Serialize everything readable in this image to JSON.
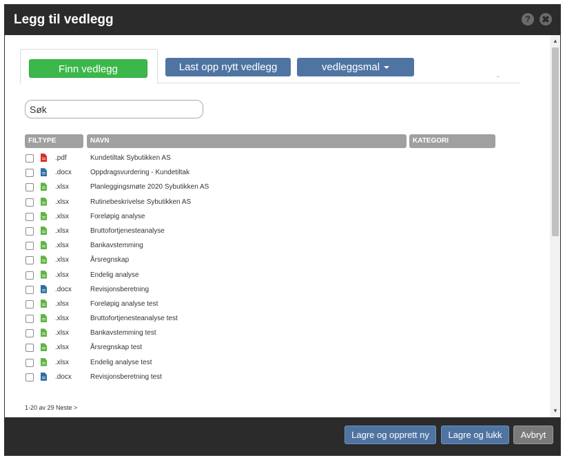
{
  "dialog": {
    "title": "Legg til vedlegg"
  },
  "header_icons": {
    "help": "?",
    "close": "✖"
  },
  "tabs": {
    "find_label": "Finn vedlegg",
    "upload_label": "Last opp nytt vedlegg",
    "template_label": "vedleggsmal"
  },
  "search": {
    "placeholder": "Søk",
    "value": ""
  },
  "columns": {
    "filtype": "FILTYPE",
    "navn": "NAVN",
    "kategori": "KATEGORI"
  },
  "file_colors": {
    "pdf": "#d9312b",
    "docx": "#2f6fa8",
    "xlsx": "#5fb543"
  },
  "files": [
    {
      "type": "pdf",
      "ext": ".pdf",
      "name": "Kundetiltak Sybutikken AS",
      "icon": "pdf-file-icon"
    },
    {
      "type": "docx",
      "ext": ".docx",
      "name": "Oppdragsvurdering - Kundetiltak",
      "icon": "word-file-icon"
    },
    {
      "type": "xlsx",
      "ext": ".xlsx",
      "name": "Planleggingsmøte 2020 Sybutikken AS",
      "icon": "excel-file-icon"
    },
    {
      "type": "xlsx",
      "ext": ".xlsx",
      "name": "Rutinebeskrivelse Sybutikken AS",
      "icon": "excel-file-icon"
    },
    {
      "type": "xlsx",
      "ext": ".xlsx",
      "name": "Foreløpig analyse",
      "icon": "excel-file-icon"
    },
    {
      "type": "xlsx",
      "ext": ".xlsx",
      "name": "Bruttofortjenesteanalyse",
      "icon": "excel-file-icon"
    },
    {
      "type": "xlsx",
      "ext": ".xlsx",
      "name": "Bankavstemming",
      "icon": "excel-file-icon"
    },
    {
      "type": "xlsx",
      "ext": ".xlsx",
      "name": "Årsregnskap",
      "icon": "excel-file-icon"
    },
    {
      "type": "xlsx",
      "ext": ".xlsx",
      "name": "Endelig analyse",
      "icon": "excel-file-icon"
    },
    {
      "type": "docx",
      "ext": ".docx",
      "name": "Revisjonsberetning",
      "icon": "word-file-icon"
    },
    {
      "type": "xlsx",
      "ext": ".xlsx",
      "name": "Foreløpig analyse test",
      "icon": "excel-file-icon"
    },
    {
      "type": "xlsx",
      "ext": ".xlsx",
      "name": "Bruttofortjenesteanalyse test",
      "icon": "excel-file-icon"
    },
    {
      "type": "xlsx",
      "ext": ".xlsx",
      "name": "Bankavstemming test",
      "icon": "excel-file-icon"
    },
    {
      "type": "xlsx",
      "ext": ".xlsx",
      "name": "Årsregnskap test",
      "icon": "excel-file-icon"
    },
    {
      "type": "xlsx",
      "ext": ".xlsx",
      "name": "Endelig analyse test",
      "icon": "excel-file-icon"
    },
    {
      "type": "docx",
      "ext": ".docx",
      "name": "Revisjonsberetning test",
      "icon": "word-file-icon"
    }
  ],
  "pagination": {
    "text": "1-20 av 29 Neste >"
  },
  "footer": {
    "save_new_label": "Lagre og opprett ny",
    "save_close_label": "Lagre og lukk",
    "cancel_label": "Avbryt"
  },
  "colors": {
    "header_bg": "#2b2b2b",
    "primary_green": "#3cb84a",
    "primary_blue": "#4f74a2",
    "column_header": "#a0a0a0",
    "cancel_gray": "#7a7a7a"
  }
}
